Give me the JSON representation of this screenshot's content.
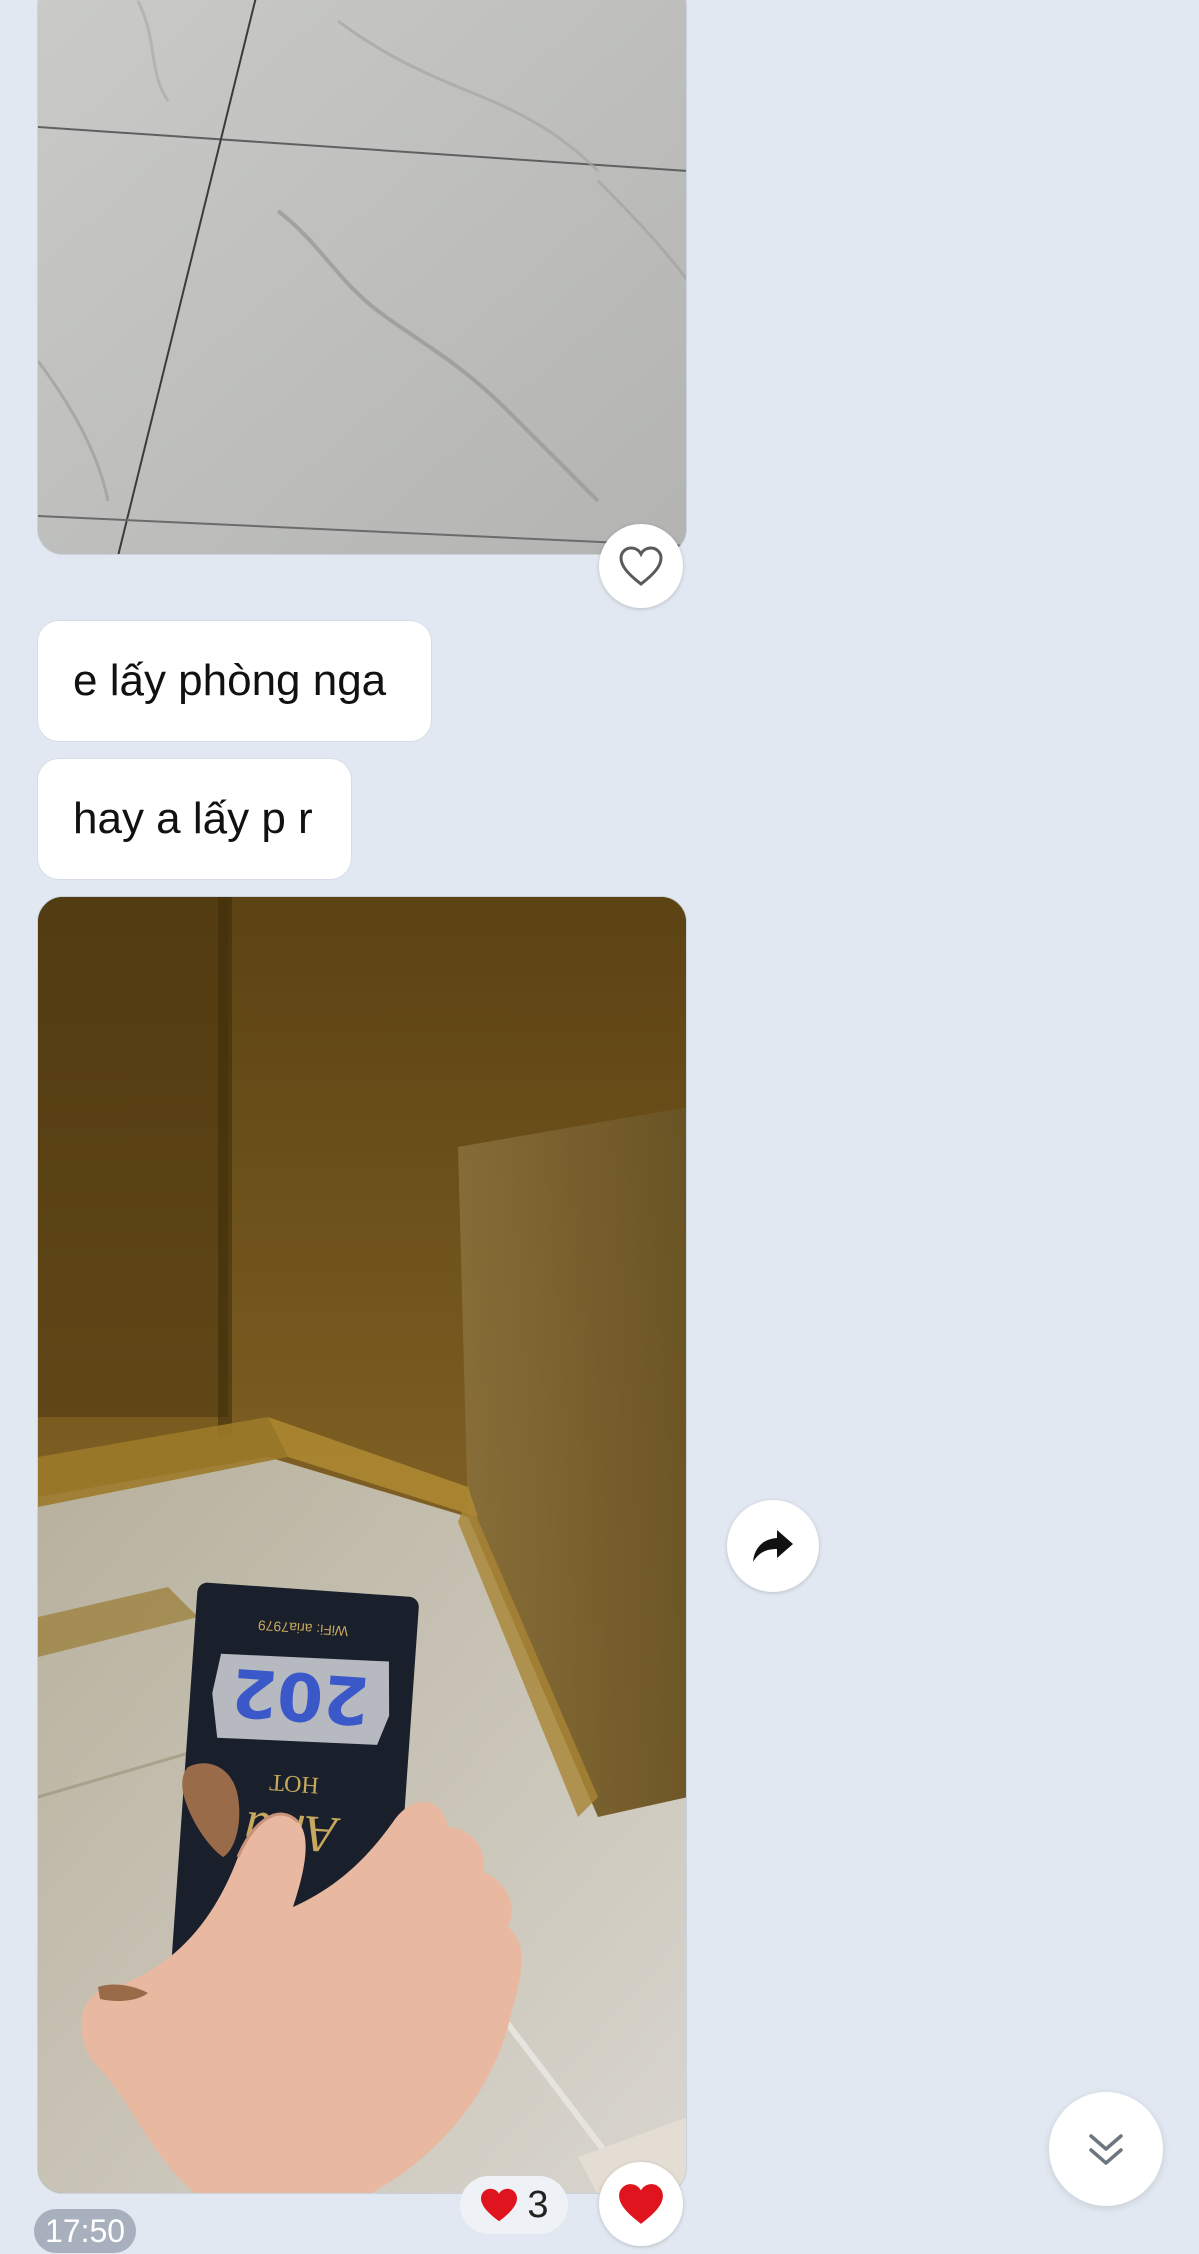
{
  "messages": [
    {
      "type": "image",
      "description_icon": "image"
    },
    {
      "type": "text",
      "text": "e lấy phòng nga"
    },
    {
      "type": "text",
      "text": "hay a lấy p r"
    },
    {
      "type": "image",
      "description_icon": "image"
    }
  ],
  "reactions": {
    "count": "3",
    "emoji_icon": "heart-icon"
  },
  "timestamp": "17:50",
  "colors": {
    "background": "#e1e8f1",
    "bubble": "#ffffff",
    "heart": "#e0141e",
    "timestamp_bg": "#a7b0bc"
  }
}
